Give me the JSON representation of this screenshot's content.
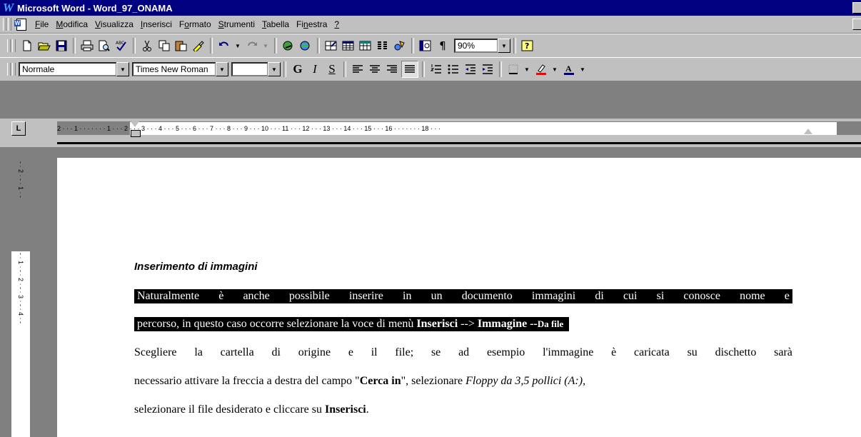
{
  "titlebar": {
    "app_icon": "W",
    "title": "Microsoft Word - Word_97_ONAMA"
  },
  "menu": {
    "items": [
      {
        "pre": "",
        "ul": "F",
        "post": "ile"
      },
      {
        "pre": "",
        "ul": "M",
        "post": "odifica"
      },
      {
        "pre": "",
        "ul": "V",
        "post": "isualizza"
      },
      {
        "pre": "",
        "ul": "I",
        "post": "nserisci"
      },
      {
        "pre": "F",
        "ul": "o",
        "post": "rmato"
      },
      {
        "pre": "",
        "ul": "S",
        "post": "trumenti"
      },
      {
        "pre": "",
        "ul": "T",
        "post": "abella"
      },
      {
        "pre": "Fi",
        "ul": "n",
        "post": "estra"
      },
      {
        "pre": "",
        "ul": "?",
        "post": ""
      }
    ]
  },
  "standard_toolbar": {
    "icons": [
      "new-doc-icon",
      "open-folder-icon",
      "save-icon",
      "print-icon",
      "print-preview-icon",
      "spelling-icon",
      "cut-icon",
      "copy-icon",
      "paste-icon",
      "format-painter-icon",
      "undo-icon",
      "redo-icon",
      "hyperlink-icon",
      "web-toolbar-icon",
      "tables-borders-icon",
      "insert-table-icon",
      "insert-excel-icon",
      "columns-icon",
      "drawing-icon",
      "document-map-icon",
      "show-hide-icon",
      "help-icon"
    ],
    "zoom": "90%"
  },
  "format_toolbar": {
    "style": "Normale",
    "font": "Times New Roman",
    "size": "",
    "bold": "G",
    "italic": "I",
    "underline": "S"
  },
  "ruler": {
    "tab_selector": "L",
    "h_labels": "2 · · · 1 · · · · · · · 1 · · · 2 · · · 3 · · · 4 · · · 5 · · · 6 · · · 7 · · · 8 · · · 9 · · · 10 · · · 11 · · · 12 · · · 13 · · · 14 · · · 15 · · · 16 · · · · · · · 18 · · ·",
    "v_labels_top": "- · 2 · - · 1 · -",
    "v_labels_body": "- · 1 · - · 2 · - · 3 · - · 4 · -"
  },
  "document": {
    "heading": "Inserimento di immagini",
    "line1_words": [
      "Naturalmente",
      "è",
      "anche",
      "possibile",
      "inserire",
      "in",
      "un",
      "documento",
      "immagini",
      "di",
      "cui",
      "si",
      "conosce",
      "nome",
      "e"
    ],
    "line2_a": "percorso, in questo caso occorre selezionare la voce di menù ",
    "line2_b": "Inserisci",
    "line2_c": " --> ",
    "line2_d": "Immagine",
    "line2_e": " --",
    "line2_f": "Da file",
    "line3_words": [
      "Scegliere",
      "la",
      "cartella",
      "di",
      "origine",
      "e",
      "il",
      "file;",
      "se",
      "ad",
      "esempio",
      "l'immagine",
      "è",
      "caricata",
      "su",
      "dischetto",
      "sarà"
    ],
    "line4_a": "necessario attivare la freccia a destra del campo \"",
    "line4_b": "Cerca in",
    "line4_c": "\", selezionare ",
    "line4_d": "Floppy da 3,5 pollici (A:)",
    "line4_e": ",",
    "line5_a": "selezionare il file desiderato e cliccare su ",
    "line5_b": "Inserisci",
    "line5_c": "."
  }
}
